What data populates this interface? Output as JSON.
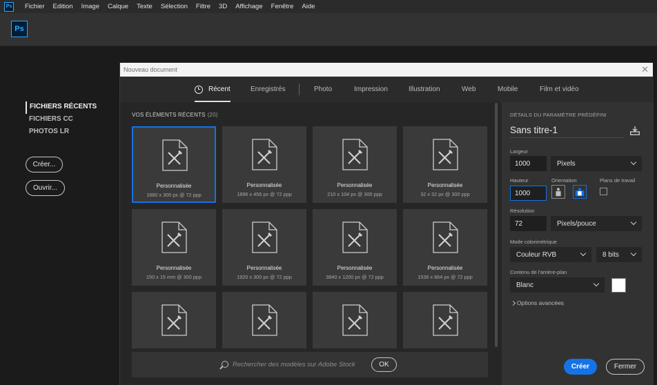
{
  "menubar": {
    "logo": "Ps",
    "items": [
      "Fichier",
      "Edition",
      "Image",
      "Calque",
      "Texte",
      "Sélection",
      "Filtre",
      "3D",
      "Affichage",
      "Fenêtre",
      "Aide"
    ]
  },
  "header": {
    "logo": "Ps"
  },
  "home": {
    "nav": [
      "FICHIERS RÉCENTS",
      "FICHIERS CC",
      "PHOTOS LR"
    ],
    "create_label": "Créer...",
    "open_label": "Ouvrir..."
  },
  "dialog": {
    "title": "Nouveau document",
    "close_glyph": "✕",
    "tabs": [
      "Récent",
      "Enregistrés",
      "Photo",
      "Impression",
      "Illustration",
      "Web",
      "Mobile",
      "Film et vidéo"
    ],
    "active_tab": "Récent",
    "recent_header": "VOS ÉLÉMENTS RÉCENTS",
    "recent_count": "(20)",
    "presets": [
      {
        "name": "Personnalisée",
        "size": "1680 x 300 px @ 72 ppp"
      },
      {
        "name": "Personnalisée",
        "size": "1896 x 456 px @ 72 ppp"
      },
      {
        "name": "Personnalisée",
        "size": "210 x 104 px @ 300 ppp"
      },
      {
        "name": "Personnalisée",
        "size": "32 x 32 px @ 300 ppp"
      },
      {
        "name": "Personnalisée",
        "size": "150 x 15 mm @ 300 ppp"
      },
      {
        "name": "Personnalisée",
        "size": "1920 x 300 px @ 72 ppp"
      },
      {
        "name": "Personnalisée",
        "size": "3840 x 1200 px @ 72 ppp"
      },
      {
        "name": "Personnalisée",
        "size": "1536 x 864 px @ 72 ppp"
      },
      {
        "name": "",
        "size": ""
      },
      {
        "name": "",
        "size": ""
      },
      {
        "name": "",
        "size": ""
      },
      {
        "name": "",
        "size": ""
      }
    ],
    "search_placeholder": "Rechercher des modèles sur Adobe Stock",
    "ok_label": "OK"
  },
  "details": {
    "header": "DÉTAILS DU PARAMÈTRE PRÉDÉFINI",
    "doc_name": "Sans titre-1",
    "width_label": "Largeur",
    "width_value": "1000",
    "width_unit": "Pixels",
    "height_label": "Hauteur",
    "height_value": "1000",
    "orientation_label": "Orientation",
    "artboards_label": "Plans de travail",
    "resolution_label": "Résolution",
    "resolution_value": "72",
    "resolution_unit": "Pixels/pouce",
    "color_mode_label": "Mode colorimétrique",
    "color_mode": "Couleur RVB",
    "bit_depth": "8 bits",
    "background_label": "Contenu de l'arrière-plan",
    "background": "Blanc",
    "background_color": "#ffffff",
    "advanced_label": "Options avancées",
    "create_label": "Créer",
    "close_label": "Fermer"
  },
  "colors": {
    "accent": "#1473e6",
    "ps_blue": "#31a8ff"
  }
}
